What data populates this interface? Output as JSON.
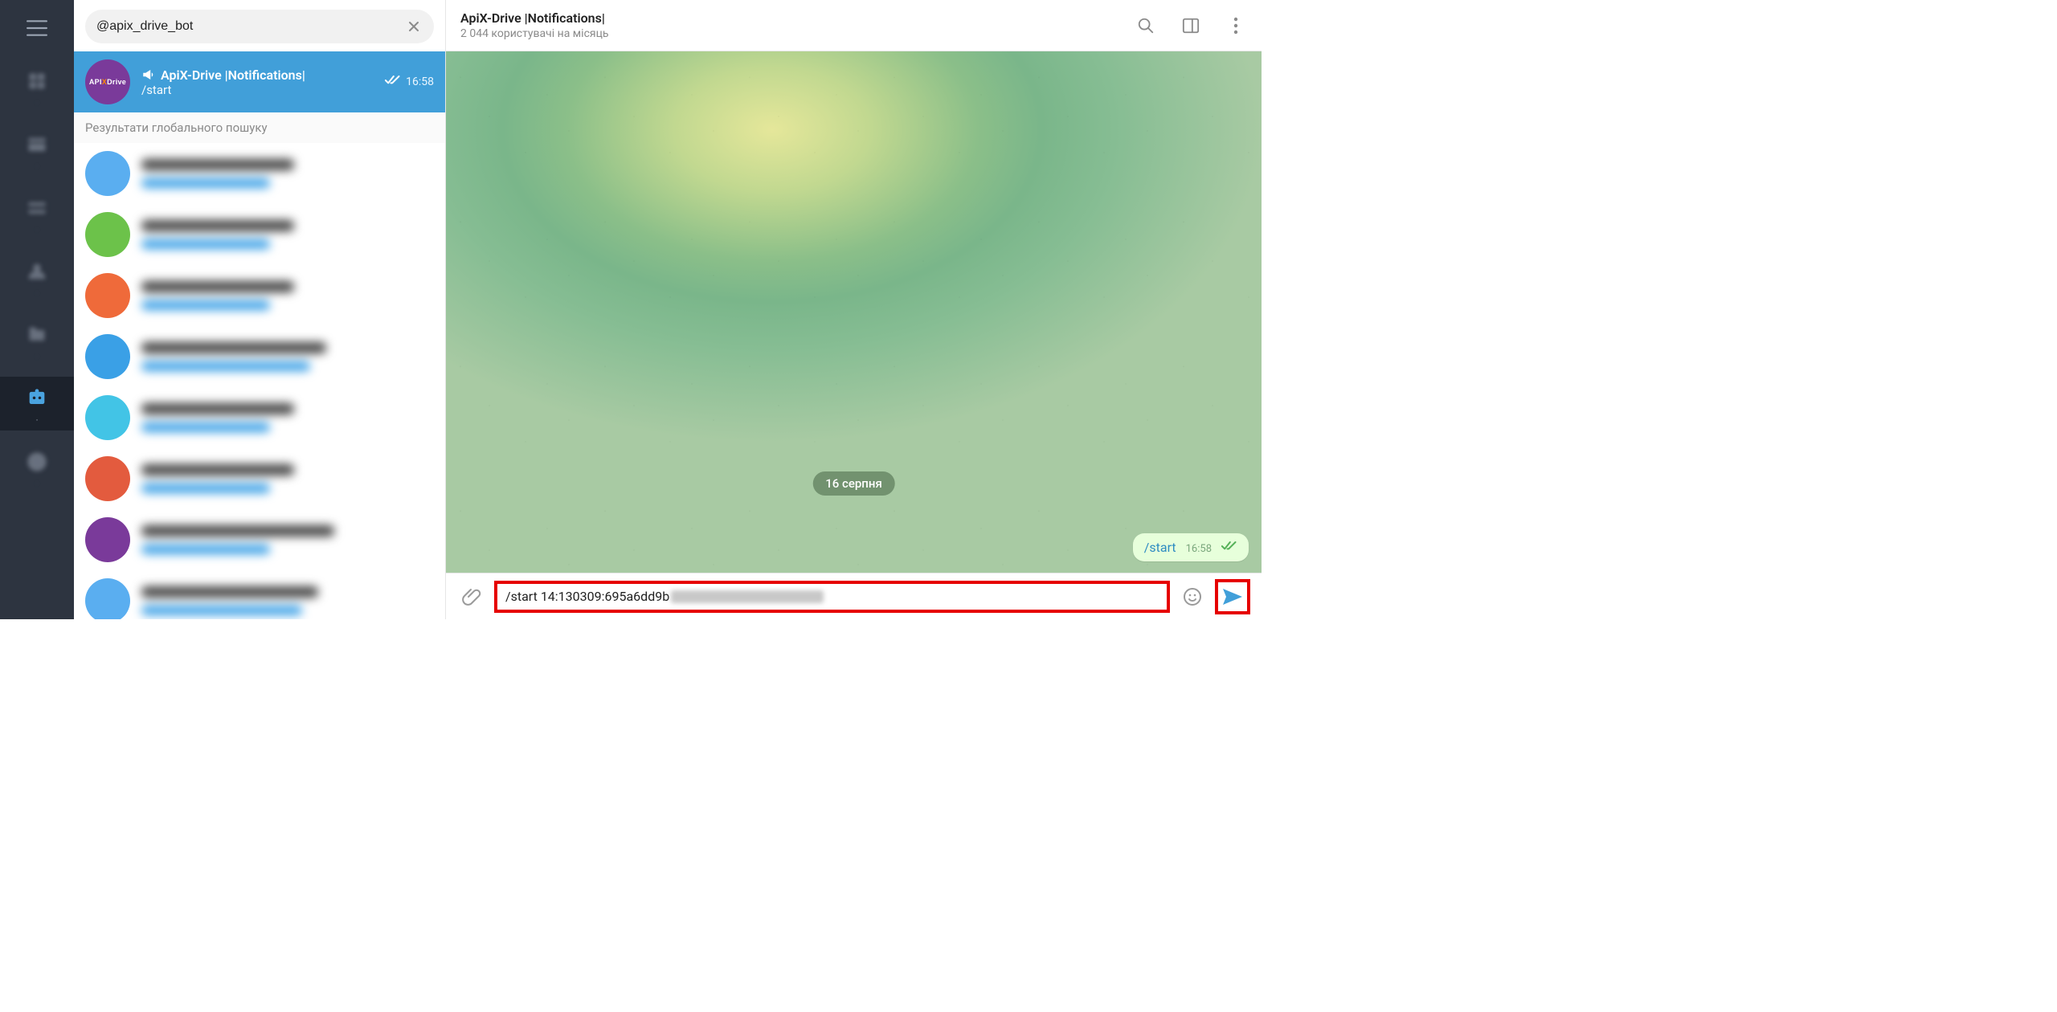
{
  "search": {
    "value": "@apix_drive_bot"
  },
  "rail": {
    "items": [
      {
        "label": ""
      },
      {
        "label": ""
      },
      {
        "label": ""
      },
      {
        "label": ""
      },
      {
        "label": ""
      },
      {
        "label": ""
      },
      {
        "label": ""
      }
    ]
  },
  "selected_chat": {
    "megaphone": true,
    "title": "ApiX-Drive |Notifications|",
    "subtitle": "/start",
    "time": "16:58"
  },
  "section_label": "Результати глобального пошуку",
  "header": {
    "title": "ApiX-Drive |Notifications|",
    "subtitle": "2 044 користувачі на місяць"
  },
  "chat": {
    "date_label": "16 серпня",
    "outgoing": {
      "text": "/start",
      "time": "16:58"
    }
  },
  "composer": {
    "value_prefix": "/start 14:130309:695a6dd9b"
  },
  "avatar_logo": {
    "api": "API",
    "x": "X",
    "drive": "Drive"
  }
}
